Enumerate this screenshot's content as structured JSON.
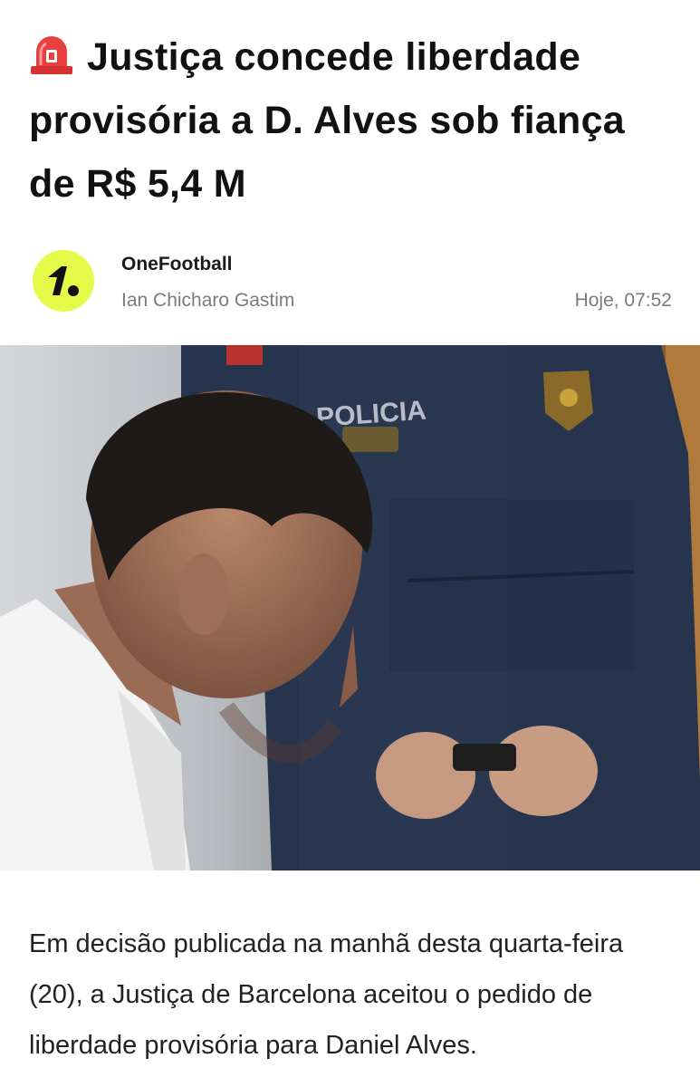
{
  "article": {
    "headline": "Justiça concede liberdade provisória a D. Alves sob fiança de R$ 5,4 M",
    "alert_icon": "siren-icon",
    "source": "OneFootball",
    "author": "Ian Chicharo Gastim",
    "published": "Hoje, 07:52",
    "photo_uniform_text": "POLICIA",
    "body": "Em decisão publicada na manhã desta quarta-feira (20), a Justiça de Barcelona aceitou o pedido de liberdade provisória para Daniel Alves."
  },
  "colors": {
    "logo_bg": "#e6fa4a",
    "siren_red": "#e23b3b",
    "meta_gray": "#7b7b7b"
  }
}
